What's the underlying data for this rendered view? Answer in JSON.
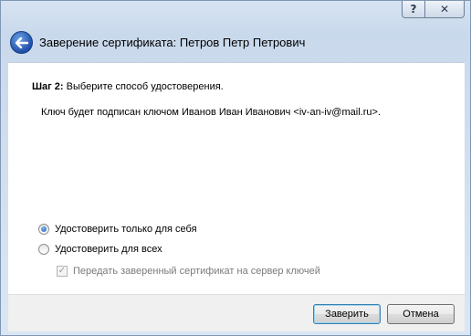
{
  "window": {
    "title": "Заверение сертификата: Петров Петр Петрович",
    "help_glyph": "?",
    "close_glyph": "✕"
  },
  "step": {
    "label": "Шаг 2:",
    "text": "Выберите способ удостоверения."
  },
  "key_info": "Ключ будет подписан ключом Иванов Иван Иванович <iv-an-iv@mail.ru>.",
  "options": {
    "self_only": {
      "label": "Удостоверить только для себя",
      "selected": true
    },
    "for_all": {
      "label": "Удостоверить для всех",
      "selected": false
    },
    "send_to_server": {
      "label": "Передать заверенный сертификат на сервер ключей",
      "checked": true,
      "enabled": false
    }
  },
  "buttons": {
    "certify": "Заверить",
    "cancel": "Отмена"
  },
  "colors": {
    "frame": "#c9d9ec",
    "back_arrow": "#1f4fa8",
    "radio_dot": "#1a5fb4",
    "default_button_border": "#3c7fb1"
  }
}
